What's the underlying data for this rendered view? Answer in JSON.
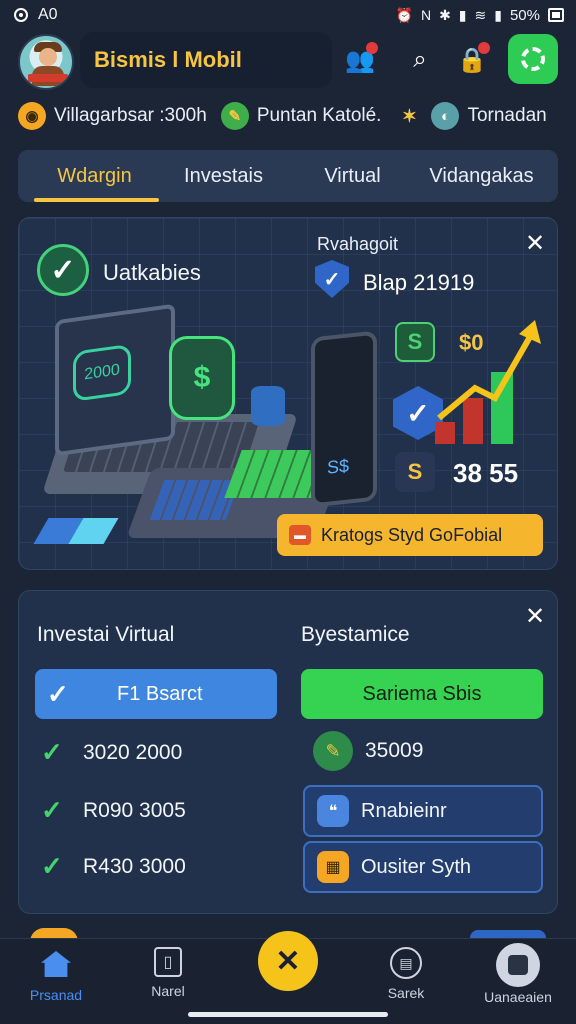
{
  "status_bar": {
    "left_text": "A0",
    "battery": "50%"
  },
  "header": {
    "title": "Bismis l Mobil"
  },
  "ticker": [
    {
      "label": "Villagarbsar :300h",
      "icon": "coin-icon",
      "color": "#f5a623"
    },
    {
      "label": "Puntan Katolé.",
      "icon": "pencil-icon",
      "color": "#3fae4a"
    },
    {
      "label": "Tornadan",
      "icon": "globe-icon",
      "color": "#5aa0a8"
    }
  ],
  "tabs": [
    {
      "label": "Wdargin",
      "active": true
    },
    {
      "label": "Investais",
      "active": false
    },
    {
      "label": "Virtual",
      "active": false
    },
    {
      "label": "Vidangakas",
      "active": false
    }
  ],
  "promo": {
    "title": "Uatkabies",
    "subtitle": "Rvahagoit",
    "value": "Blap 21919",
    "screen_value": "2000",
    "phone_label": "S$",
    "mini_value": "$0",
    "big_value": "38 55",
    "cta_label": "Kratogs Styd GoFobial"
  },
  "investment": {
    "left_title": "Investai Virtual",
    "right_title": "Byestamice",
    "blue_button": "F1 Bsarct",
    "green_button": "Sariema Sbis",
    "rows": [
      "3020 2000",
      "R090 3005",
      "R430 3000"
    ],
    "right_value": "35009",
    "options": [
      {
        "label": "Rnabieinr",
        "icon": "chat-icon"
      },
      {
        "label": "Ousiter Syth",
        "icon": "bank-icon"
      }
    ]
  },
  "bottom_nav": [
    {
      "label": "Prsanad",
      "icon": "home-icon",
      "active": true
    },
    {
      "label": "Narel",
      "icon": "book-icon",
      "active": false
    },
    {
      "label": "",
      "icon": "person-icon",
      "active": false
    },
    {
      "label": "Sarek",
      "icon": "calculator-icon",
      "active": false
    },
    {
      "label": "Uanaeaien",
      "icon": "profile-icon",
      "active": false
    }
  ]
}
